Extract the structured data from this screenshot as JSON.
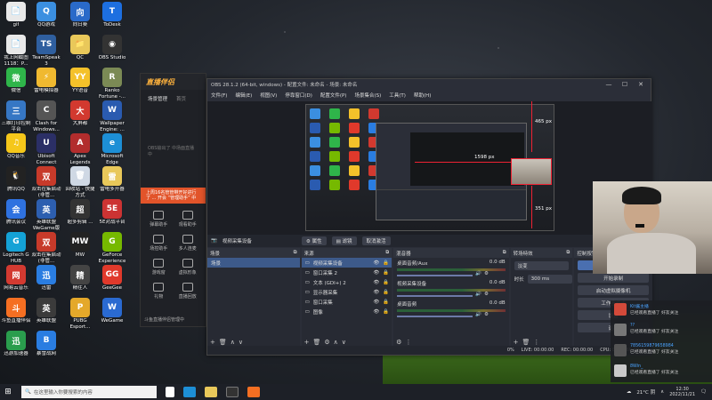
{
  "desktop": {
    "icons": [
      {
        "label": "gif",
        "color": "#e9e9e9",
        "glyph": "📄"
      },
      {
        "label": "QQ游戏",
        "color": "#3b8fe0",
        "glyph": "Q"
      },
      {
        "label": "向日葵",
        "color": "#2a6ac9",
        "glyph": "向"
      },
      {
        "label": "ToDesk",
        "color": "#1d6fe0",
        "glyph": "T"
      },
      {
        "label": "我上网截图1118：P...",
        "color": "#e9e9e9",
        "glyph": "📄"
      },
      {
        "label": "TeamSpeak 3",
        "color": "#2f5f9f",
        "glyph": "TS"
      },
      {
        "label": "QC",
        "color": "#e9c85a",
        "glyph": "📁"
      },
      {
        "label": "OBS Studio",
        "color": "#333",
        "glyph": "◉"
      },
      {
        "label": "微信",
        "color": "#2fb54a",
        "glyph": "微"
      },
      {
        "label": "雷电模拟器",
        "color": "#f0b930",
        "glyph": "⚡"
      },
      {
        "label": "YY语音",
        "color": "#f4c12a",
        "glyph": "YY"
      },
      {
        "label": "Ranko Fortune -...",
        "color": "#7b8a55",
        "glyph": "R"
      },
      {
        "label": "三维打印控制平台",
        "color": "#3677c4",
        "glyph": "三"
      },
      {
        "label": "Clash for Windows...",
        "color": "#555",
        "glyph": "C"
      },
      {
        "label": "大屏都",
        "color": "#d2392f",
        "glyph": "大"
      },
      {
        "label": "Wallpaper Engine: ...",
        "color": "#2a5bb0",
        "glyph": "W"
      },
      {
        "label": "QQ音乐",
        "color": "#f5c71a",
        "glyph": "♫"
      },
      {
        "label": "Ubisoft Connect",
        "color": "#2b2f66",
        "glyph": "U"
      },
      {
        "label": "Apex Legends",
        "color": "#b22d2d",
        "glyph": "A"
      },
      {
        "label": "Microsoft Edge",
        "color": "#1d8fd6",
        "glyph": "e"
      },
      {
        "label": "腾讯QQ",
        "color": "#222",
        "glyph": "🐧"
      },
      {
        "label": "双击在集启动 (非管...",
        "color": "#c73a2a",
        "glyph": "双"
      },
      {
        "label": "回收站 - 快捷方式",
        "color": "#cfd8e4",
        "glyph": "🗑"
      },
      {
        "label": "雷电多开器",
        "color": "#e9c85a",
        "glyph": "雷"
      },
      {
        "label": "腾讯会议",
        "color": "#2f72e0",
        "glyph": "会"
      },
      {
        "label": "英雄联盟WeGame版",
        "color": "#2d5fb0",
        "glyph": "英"
      },
      {
        "label": "超多剪辑 ...",
        "color": "#333",
        "glyph": "超"
      },
      {
        "label": "5E对战平台",
        "color": "#c33",
        "glyph": "5E"
      },
      {
        "label": "Logitech G HUB",
        "color": "#14a2d6",
        "glyph": "G"
      },
      {
        "label": "双击在集启动 (非管...",
        "color": "#c73a2a",
        "glyph": "双"
      },
      {
        "label": "MW",
        "color": "#222",
        "glyph": "MW"
      },
      {
        "label": "GeForce Experience",
        "color": "#76b900",
        "glyph": "G"
      },
      {
        "label": "网易云音乐",
        "color": "#d33a31",
        "glyph": "网"
      },
      {
        "label": "迅雷",
        "color": "#2a7de1",
        "glyph": "迅"
      },
      {
        "label": "精往人",
        "color": "#444",
        "glyph": "精"
      },
      {
        "label": "GeeGee",
        "color": "#e0392b",
        "glyph": "GG"
      },
      {
        "label": "斗鱼直播伴侣",
        "color": "#f56f22",
        "glyph": "斗"
      },
      {
        "label": "英雄联盟",
        "color": "#3b3b3b",
        "glyph": "英"
      },
      {
        "label": "PUBG Esport...",
        "color": "#e4a82a",
        "glyph": "P"
      },
      {
        "label": "WeGame",
        "color": "#2a6ad1",
        "glyph": "W"
      },
      {
        "label": "迅游加速器",
        "color": "#2a9d4d",
        "glyph": "迅"
      },
      {
        "label": "暴雪战网",
        "color": "#2a7de1",
        "glyph": "B"
      }
    ]
  },
  "helper_app": {
    "logo": "直播伴侣",
    "tabs": [
      "场景管理",
      "首页"
    ],
    "hint": "OBS输出了 中场面直播中",
    "notice": "上周16名管管带开好进行了 ... 开会 “管理助手” 中",
    "tools": [
      "弹幕助手",
      "观看助手",
      "场控助手",
      "多人连麦",
      "游戏窗",
      "虚拟形象",
      "礼物",
      "直播回放"
    ],
    "footer": "斗鱼直播伴侣管理中"
  },
  "obs": {
    "title": "OBS 28.1.2 (64-bit, windows) - 配置文件: 未命名 - 场景: 未命名",
    "menu": [
      "文件(F)",
      "编辑(E)",
      "视图(V)",
      "停靠窗口(D)",
      "配置文件(P)",
      "场景集合(S)",
      "工具(T)",
      "帮助(H)"
    ],
    "preview_labels": {
      "top": "465 px",
      "left": "1598 px",
      "bottom": "351 px"
    },
    "source_bar": {
      "name": "视频采集设备",
      "props": "属性",
      "filters": "滤镜",
      "deactivate": "取消激活"
    },
    "scenes": {
      "header": "场景",
      "items": [
        "场景"
      ]
    },
    "sources": {
      "header": "来源",
      "items": [
        "视频采集设备",
        "窗口采集 2",
        "文本 (GDI+) 2",
        "显示器采集",
        "窗口采集",
        "图像"
      ]
    },
    "mixer": {
      "header": "混音器",
      "channels": [
        {
          "name": "桌面音频/Aux",
          "db": "0.0 dB"
        },
        {
          "name": "视频采集设备",
          "db": "0.0 dB"
        },
        {
          "name": "桌面音频",
          "db": "0.0 dB"
        }
      ]
    },
    "transitions": {
      "header": "转场特效",
      "selected": "淡变",
      "duration_label": "时长",
      "duration": "300 ms"
    },
    "controls": {
      "header": "控制按钮",
      "buttons": [
        "停止直播",
        "开始录制",
        "启动虚拟摄像机",
        "工作室模式",
        "设置",
        "退出"
      ]
    },
    "status": {
      "dropped": "0%",
      "live": "LIVE: 00:00:00",
      "rec": "REC: 00:00:00",
      "cpu": "CPU: 0.4%, 60.00 fps"
    }
  },
  "notifications": [
    {
      "name": "Kit酱主播",
      "text": "已经观看直播了 好友关注",
      "color": "#d34a3a"
    },
    {
      "name": "??",
      "text": "已经观看直播了 好友关注",
      "color": "#777"
    },
    {
      "name": "7856159879658984",
      "text": "已经观看直播了 好友关注",
      "color": "#555"
    },
    {
      "name": "8Win_",
      "text": "已经观看直播了 好友关注",
      "color": "#c9c9c9"
    }
  ],
  "taskbar": {
    "search_placeholder": "在这里输入你要搜索的内容",
    "weather": "21°C 阴",
    "time": "12:30",
    "date": "2022/11/21"
  }
}
